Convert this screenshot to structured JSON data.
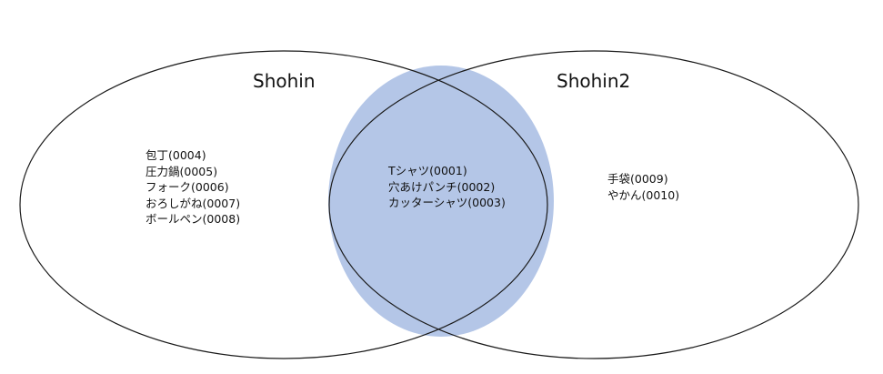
{
  "diagram": {
    "type": "venn",
    "highlight_color": "#b4c6e7",
    "outline_color": "#1a1a1a",
    "highlighted_region": "intersection",
    "sets": [
      {
        "title": "Shohin",
        "only_items": [
          "包丁(0004)",
          "圧力鍋(0005)",
          "フォーク(0006)",
          "おろしがね(0007)",
          "ボールペン(0008)"
        ]
      },
      {
        "title": "Shohin2",
        "only_items": [
          "手袋(0009)",
          "やかん(0010)"
        ]
      }
    ],
    "intersection_items": [
      "Tシャツ(0001)",
      "穴あけパンチ(0002)",
      "カッターシャツ(0003)"
    ]
  }
}
